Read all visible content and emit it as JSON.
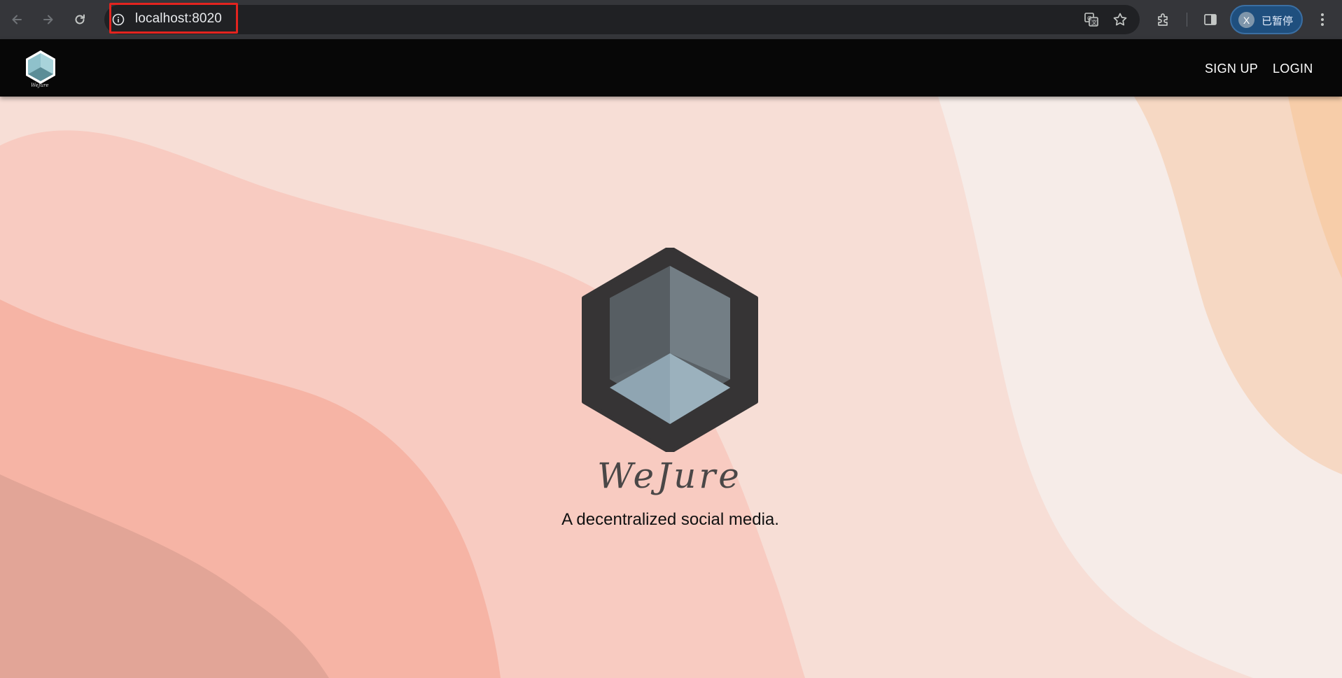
{
  "browser": {
    "url": "localhost:8020",
    "profile": {
      "initial": "X",
      "status": "已暂停"
    },
    "icons": [
      "back-arrow-icon",
      "forward-arrow-icon",
      "reload-icon",
      "site-info-icon",
      "translate-icon",
      "bookmark-star-icon",
      "extensions-icon",
      "side-panel-icon",
      "kebab-menu-icon"
    ]
  },
  "navbar": {
    "logo_text": "WeJure",
    "links": {
      "signup": "SIGN UP",
      "login": "LOGIN"
    }
  },
  "hero": {
    "title": "WeJure",
    "tagline": "A decentralized social media."
  },
  "colors": {
    "chrome_bg": "#35363a",
    "omnibox_bg": "#202124",
    "highlight": "#e3241f",
    "navbar_bg": "#070707",
    "wave_1": "#f7ded6",
    "wave_2": "#f8cfc5",
    "wave_3": "#f6b5a5",
    "wave_4": "#e0a597",
    "wave_light": "#f6e6e1",
    "wave_peach": "#f6d4b5",
    "logo_hex": "#363435",
    "logo_cube": "#5f676c"
  }
}
